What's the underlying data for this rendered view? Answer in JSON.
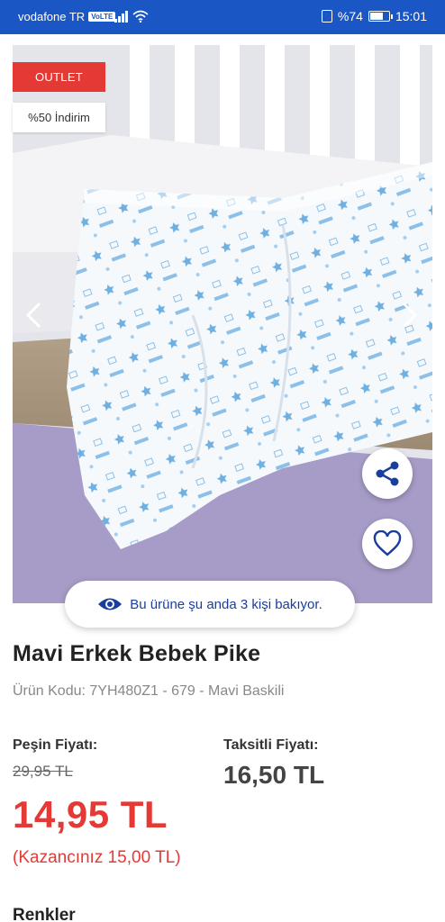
{
  "status_bar": {
    "carrier": "vodafone TR",
    "volte": "VoLTE",
    "battery_text": "%74",
    "battery_level": 0.74,
    "time": "15:01"
  },
  "badges": {
    "outlet": "OUTLET",
    "discount": "%50 İndirim"
  },
  "viewers": {
    "text": "Bu ürüne şu anda 3 kişi bakıyor."
  },
  "product": {
    "title": "Mavi Erkek Bebek Pike",
    "code_line": "Ürün Kodu: 7YH480Z1 - 679 - Mavi Baskili"
  },
  "pricing": {
    "cash_label": "Peşin Fiyatı:",
    "old_price": "29,95 TL",
    "new_price": "14,95 TL",
    "saving": "(Kazancınız 15,00 TL)",
    "installment_label": "Taksitli Fiyatı:",
    "installment_price": "16,50 TL"
  },
  "sections": {
    "colors": "Renkler"
  },
  "colors": {
    "brand_blue": "#1a56c4",
    "accent_red": "#e53935",
    "viewer_blue": "#1a3e9e"
  },
  "icons": [
    "chevron-left-icon",
    "chevron-right-icon",
    "share-icon",
    "heart-icon",
    "eye-icon"
  ]
}
